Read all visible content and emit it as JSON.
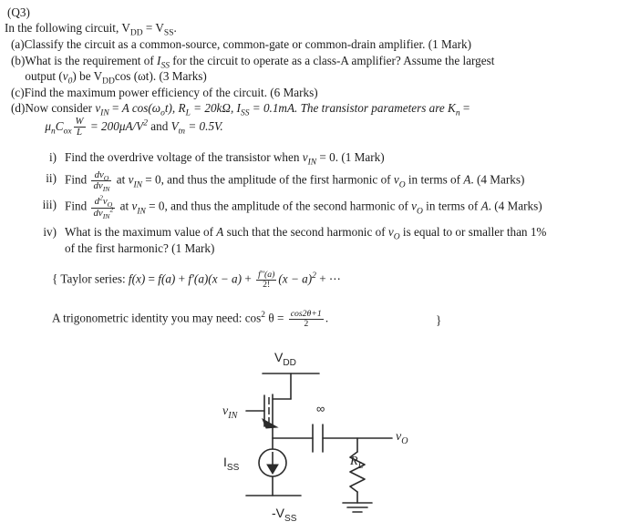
{
  "document": {
    "question_number": "(Q3)",
    "intro": {
      "pre": "In the following circuit, ",
      "v_dd": "V",
      "v_dd_sub": "DD",
      "eq": " = ",
      "v_ss": "V",
      "v_ss_sub": "SS",
      "post": "."
    },
    "parts": [
      {
        "marker": "(a)",
        "text": "Classify the circuit as a common-source, common-gate or common-drain amplifier.  (1 Mark)"
      },
      {
        "marker": "(b)",
        "line1_a": "What is the requirement of ",
        "line1_iss": "I",
        "line1_iss_sub": "SS",
        "line1_b": " for the circuit to operate as a class-A amplifier? Assume the largest",
        "line2_a": "output (",
        "line2_vo": "v",
        "line2_vo_sub": "0",
        "line2_b": ") be V",
        "line2_c_sub": "DD",
        "line2_d": "cos (ωt).  (3 Marks)"
      },
      {
        "marker": "(c)",
        "text": "Find the maximum power efficiency of the circuit. (6 Marks)"
      },
      {
        "marker": "(d)",
        "line1_a": "Now consider ",
        "line1_vin": "v",
        "line1_vin_sub": "IN",
        "line1_b": " = ",
        "line1_c": "A cos",
        "line1_d": "(ω",
        "line1_e_sub": "o",
        "line1_f": "t), ",
        "line1_rl": "R",
        "line1_rl_sub": "L",
        "line1_g": " = 20kΩ, ",
        "line1_iss": "I",
        "line1_iss_sub": "SS",
        "line1_h": " = 0.1mA. The transistor parameters are ",
        "line1_kn": "K",
        "line1_kn_sub": "n",
        "line1_i": " = ",
        "line2_mu": "μ",
        "line2_mu_sub": "n",
        "line2_cox": "C",
        "line2_cox_sub": "ox",
        "line2_frac_num": "W",
        "line2_frac_den": "L",
        "line2_a": " = 200μA/V",
        "line2_sup": "2",
        "line2_b": " and ",
        "line2_vtn": "V",
        "line2_vtn_sub": "tn",
        "line2_c": " = 0.5V."
      }
    ],
    "subparts": [
      {
        "marker": "i)",
        "a": "Find the overdrive voltage of the transistor when ",
        "vin": "v",
        "vin_sub": "IN",
        "b": " = 0. (1 Mark)"
      },
      {
        "marker": "ii)",
        "a": "Find ",
        "frac_num_d": "d",
        "frac_num_v": "v",
        "frac_num_sub": "O",
        "frac_den_d": "d",
        "frac_den_v": "v",
        "frac_den_sub": "IN",
        "b": " at ",
        "vin": "v",
        "vin_sub": "IN",
        "c": " = 0, and thus the amplitude of the first harmonic of ",
        "vo": "v",
        "vo_sub": "O",
        "d": " in terms of ",
        "amp": "A",
        "e": ". (4 Marks)"
      },
      {
        "marker": "iii)",
        "a": "Find ",
        "frac_num_d": "d",
        "frac_num_sup": "2",
        "frac_num_v": "v",
        "frac_num_sub": "O",
        "frac_den_d": "d",
        "frac_den_v": "v",
        "frac_den_sub": "IN",
        "frac_den_sup": "2",
        "b": " at ",
        "vin": "v",
        "vin_sub": "IN",
        "c": " = 0, and thus the amplitude of the second harmonic of ",
        "vo": "v",
        "vo_sub": "O",
        "d": " in terms of ",
        "amp": "A",
        "e": ". (4 Marks)"
      },
      {
        "marker": "iv)",
        "a": "What is the maximum value of ",
        "amp": "A",
        "b": " such that the second harmonic of ",
        "vo": "v",
        "vo_sub": "O",
        "c": " is equal to or smaller than 1%",
        "line2": "of the first harmonic? (1 Mark)"
      }
    ],
    "hints": {
      "taylor": {
        "open_brace": "{",
        "label": "Taylor series: ",
        "f": "f",
        "x1": "(x)",
        "eq": " = ",
        "fa": "f",
        "a1": "(a)",
        "plus1": " + ",
        "fp": "f′",
        "a2": "(a)(x − a)",
        "plus2": " + ",
        "frac_num": "f′′(a)",
        "frac_den": "2!",
        "tail": "(x − a)",
        "tail_sup": "2",
        "tail_end": " + ⋯"
      },
      "trig": {
        "label": "A trigonometric identity you may need: cos",
        "sup": "2",
        "theta": " θ",
        "eq": " = ",
        "frac_num": "cos2θ+1",
        "frac_den": "2",
        "period": ".",
        "close_brace": "}"
      }
    },
    "circuit": {
      "name": "common-drain-source-follower-amplifier",
      "labels": {
        "vdd": "V",
        "vdd_sub": "DD",
        "vss": "-V",
        "vss_sub": "SS",
        "iss": "I",
        "iss_sub": "SS",
        "vin": "v",
        "vin_sub": "IN",
        "vo": "v",
        "vo_sub": "O",
        "rl": "R",
        "rl_sub": "L",
        "cap_value": "∞"
      },
      "colors": {
        "wire": "#2b2b2b",
        "background": "#ffffff"
      }
    }
  }
}
